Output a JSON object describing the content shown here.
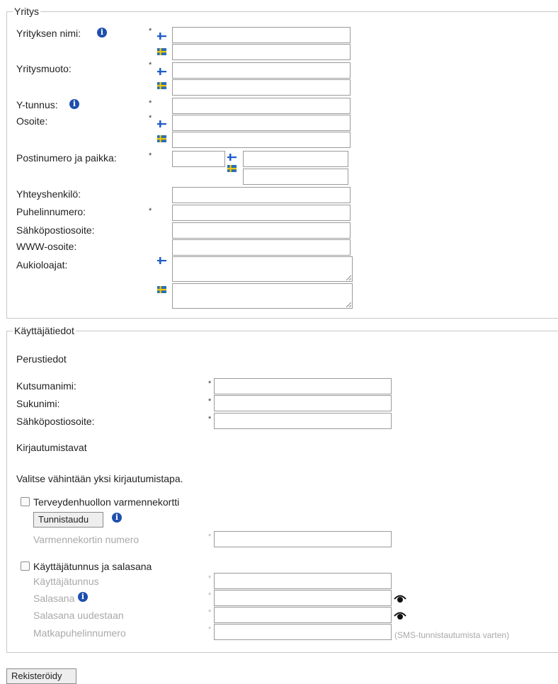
{
  "company": {
    "legend": "Yritys",
    "name_label": "Yrityksen nimi:",
    "form_label": "Yritysmuoto:",
    "businessid_label": "Y-tunnus:",
    "address_label": "Osoite:",
    "postal_label": "Postinumero ja paikka:",
    "contact_label": "Yhteyshenkilö:",
    "phone_label": "Puhelinnumero:",
    "email_label": "Sähköpostiosoite:",
    "www_label": "WWW-osoite:",
    "hours_label": "Aukioloajat:",
    "required_mark": "*",
    "info_glyph": "i",
    "flags": {
      "fi": "finland-flag-icon",
      "sv": "sweden-flag-icon"
    }
  },
  "user": {
    "legend": "Käyttäjätiedot",
    "basic_heading": "Perustiedot",
    "nickname_label": "Kutsumanimi:",
    "lastname_label": "Sukunimi:",
    "email_label": "Sähköpostiosoite:",
    "login_heading": "Kirjautumistavat",
    "login_instruction": "Valitse vähintään yksi kirjautumistapa.",
    "card": {
      "checkbox_label": "Terveydenhuollon varmennekortti",
      "identify_button": "Tunnistaudu",
      "card_number_label": "Varmennekortin numero"
    },
    "credentials": {
      "checkbox_label": "Käyttäjätunnus ja salasana",
      "username_label": "Käyttäjätunnus",
      "password_label": "Salasana",
      "password_again_label": "Salasana uudestaan",
      "mobile_label": "Matkapuhelinnumero",
      "mobile_hint": "(SMS-tunnistautumista varten)"
    }
  },
  "register_button": "Rekisteröidy",
  "colors": {
    "info_icon": "#1f4fae",
    "fi_blue": "#1d5cc8",
    "se_blue": "#2a6fb3",
    "se_yellow": "#f3c800"
  }
}
